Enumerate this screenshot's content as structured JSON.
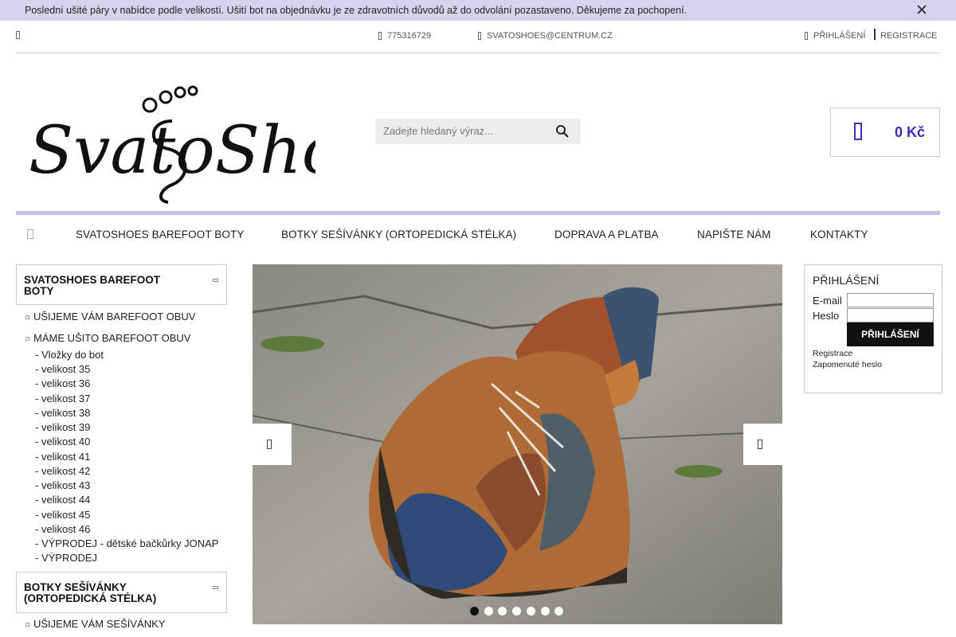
{
  "notice": {
    "text": "Poslední ušité páry v nabídce podle velikostí. Ušití bot na objednávku je ze zdravotních důvodů až do odvolání pozastaveno. Děkujeme za pochopení.",
    "close_icon": "close-icon"
  },
  "topbar": {
    "phone": "775316729",
    "email": "SVATOSHOES@CENTRUM.CZ",
    "login": "PŘIHLÁŠENÍ",
    "register": "REGISTRACE"
  },
  "logo": {
    "text": "SvatoShoes"
  },
  "search": {
    "placeholder": "Zadejte hledaný výraz..."
  },
  "cart": {
    "price": "0 Kč"
  },
  "colors": {
    "accent": "#3d2bc4",
    "notice_bg": "#d9d2ec",
    "nav_line": "#c7bde5"
  },
  "nav": [
    "SVATOSHOES BAREFOOT BOTY",
    "BOTKY SEŠÍVÁNKY (ORTOPEDICKÁ STÉLKA)",
    "DOPRAVA A PLATBA",
    "NAPIŠTE NÁM",
    "KONTAKTY"
  ],
  "sidebar": {
    "cat1": {
      "title_line1": "SVATOSHOES BAREFOOT",
      "title_line2": "BOTY",
      "sub1": "UŠIJEME VÁM BAREFOOT OBUV",
      "sub2": "MÁME UŠITO BAREFOOT OBUV",
      "subsub": [
        "- Vložky do bot",
        "- velikost 35",
        "- velikost 36",
        "- velikost 37",
        "- velikost 38",
        "- velikost 39",
        "- velikost 40",
        "- velikost 41",
        "- velikost 42",
        "- velikost 43",
        "- velikost 44",
        "- velikost 45",
        "- velikost 46",
        "- VÝPRODEJ - dětské bačkůrky JONAP",
        "- VÝPRODEJ"
      ]
    },
    "cat2": {
      "title_line1": "BOTKY SEŠÍVÁNKY",
      "title_line2": "(ORTOPEDICKÁ STÉLKA)",
      "sub1": "UŠIJEME VÁM SEŠÍVÁNKY"
    }
  },
  "slider": {
    "dots": 7,
    "active_dot": 0
  },
  "login_box": {
    "title": "PŘIHLÁŠENÍ",
    "email_label": "E-mail",
    "password_label": "Heslo",
    "button": "PŘIHLÁŠENÍ",
    "register_link": "Registrace",
    "forgot_link": "Zapomenuté heslo"
  }
}
